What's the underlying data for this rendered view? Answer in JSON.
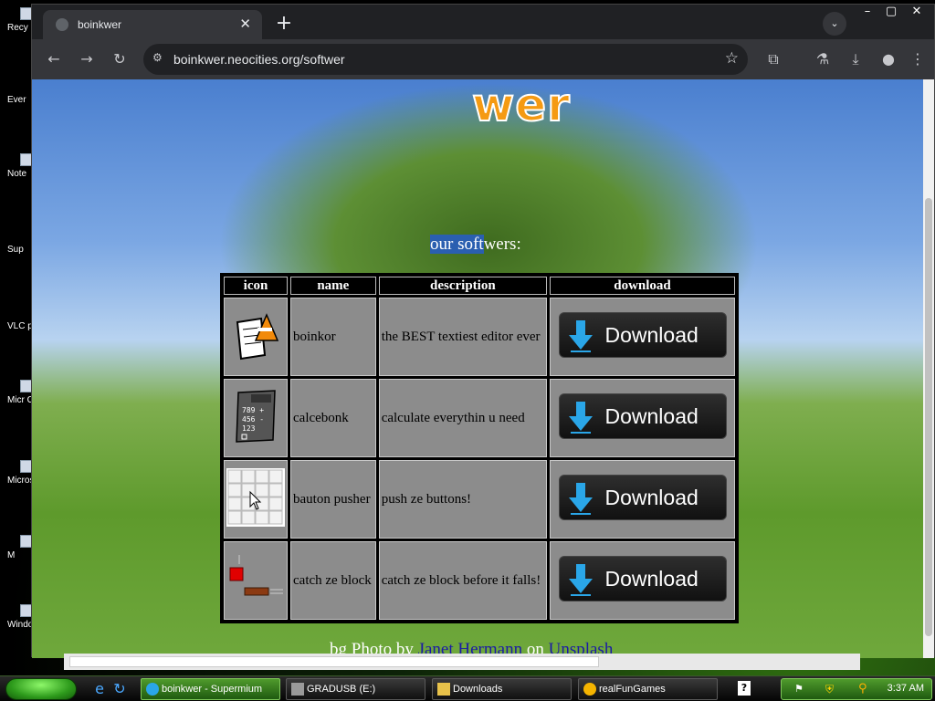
{
  "desktop": {
    "icons": [
      "Recy",
      "Ever",
      "Note",
      "Sup",
      "VLC pl",
      "Micr Offi",
      "Micros Stud",
      "M",
      "Windo M"
    ]
  },
  "browser": {
    "tab_title": "boinkwer",
    "url": "boinkwer.neocities.org/softwer"
  },
  "page": {
    "logo_partial": "wer",
    "heading_highlight": "our soft",
    "heading_rest": "wers:",
    "table": {
      "headers": [
        "icon",
        "name",
        "description",
        "download"
      ],
      "rows": [
        {
          "icon": "notepad-cone-icon",
          "name": "boinkor",
          "description": "the BEST textiest editor ever",
          "download_label": "Download"
        },
        {
          "icon": "calculator-icon",
          "name": "calcebonk",
          "description": "calculate everythin u need",
          "download_label": "Download"
        },
        {
          "icon": "button-grid-icon",
          "name": "bauton pusher",
          "description": "push ze buttons!",
          "download_label": "Download"
        },
        {
          "icon": "falling-block-icon",
          "name": "catch ze block",
          "description": "catch ze block before it falls!",
          "download_label": "Download"
        }
      ]
    },
    "credit": {
      "prefix": "bg Photo by ",
      "author": "Janet Hermann",
      "middle": " on ",
      "site": "Unsplash"
    }
  },
  "taskbar": {
    "tasks": [
      {
        "label": "boinkwer - Supermium",
        "active": true
      },
      {
        "label": "GRADUSB (E:)",
        "active": false
      },
      {
        "label": "Downloads",
        "active": false
      },
      {
        "label": "realFunGames",
        "active": false
      }
    ],
    "clock": "3:37 AM"
  },
  "colors": {
    "logo_orange": "#f59a12",
    "table_cell": "#8c8c8c",
    "link": "#1a1aa6",
    "taskbar_green": "#4f9a2c"
  }
}
